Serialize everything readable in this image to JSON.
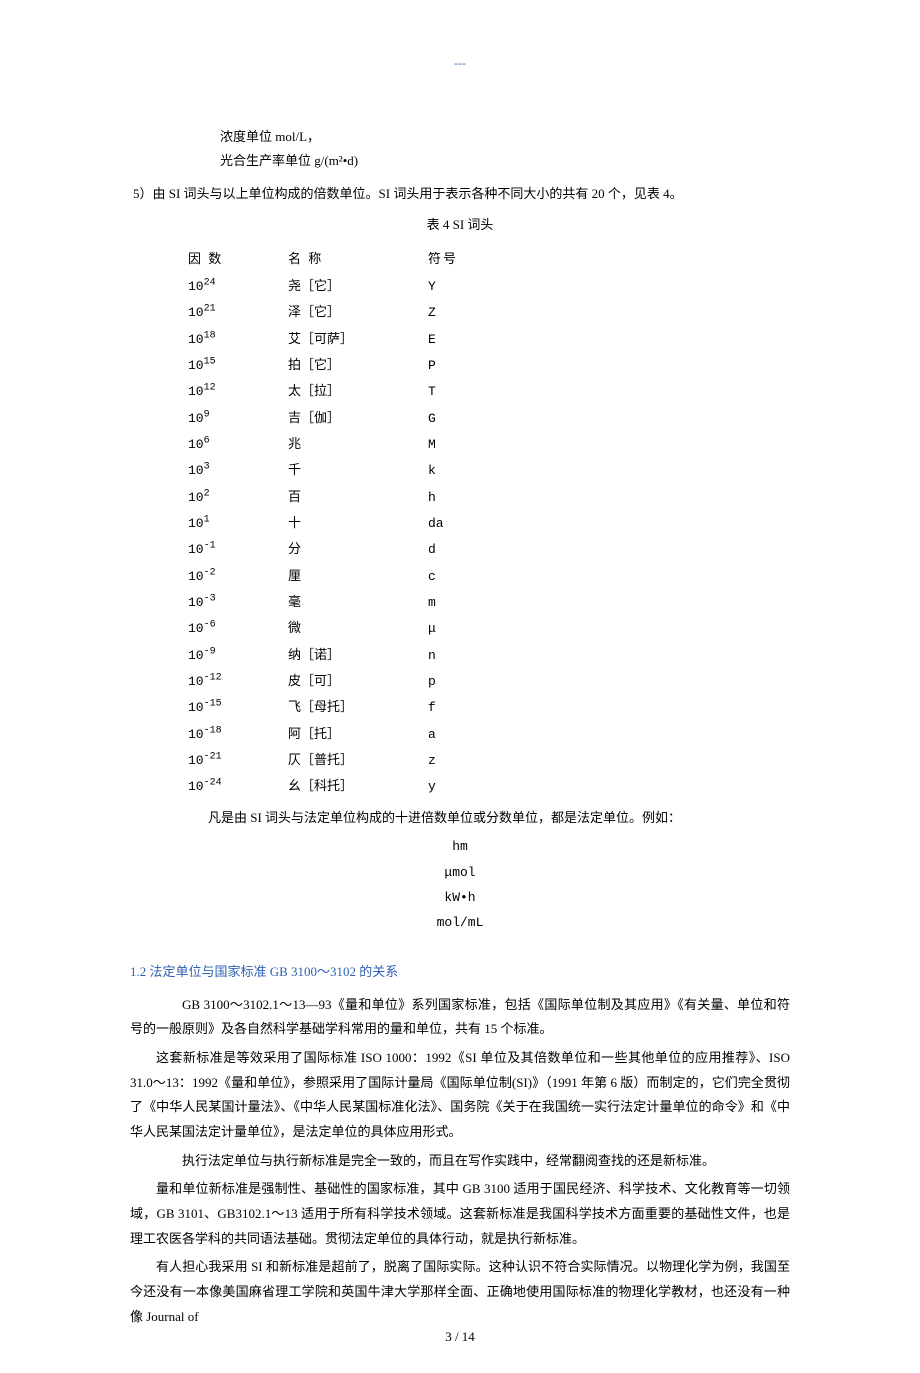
{
  "running_head": "---",
  "intro_lines": {
    "l1": "浓度单位 mol/L，",
    "l2": "光合生产率单位 g/(m²•d)",
    "l3": "5）由 SI 词头与以上单位构成的倍数单位。SI 词头用于表示各种不同大小的共有 20 个，见表 4。"
  },
  "table4": {
    "caption": "表 4  SI 词头",
    "header": {
      "c1": "因  数",
      "c2": "名  称",
      "c3": "符号"
    },
    "rows": [
      {
        "factor_base": "10",
        "factor_exp": "24",
        "name": "尧［它］",
        "symbol": "Y"
      },
      {
        "factor_base": "10",
        "factor_exp": "21",
        "name": "泽［它］",
        "symbol": "Z"
      },
      {
        "factor_base": "10",
        "factor_exp": "18",
        "name": "艾［可萨］",
        "symbol": "E"
      },
      {
        "factor_base": "10",
        "factor_exp": "15",
        "name": "拍［它］",
        "symbol": "P"
      },
      {
        "factor_base": "10",
        "factor_exp": "12",
        "name": "太［拉］",
        "symbol": "T"
      },
      {
        "factor_base": "10",
        "factor_exp": "9",
        "name": "吉［伽］",
        "symbol": "G"
      },
      {
        "factor_base": "10",
        "factor_exp": "6",
        "name": "兆",
        "symbol": "M"
      },
      {
        "factor_base": "10",
        "factor_exp": "3",
        "name": "千",
        "symbol": "k"
      },
      {
        "factor_base": "10",
        "factor_exp": "2",
        "name": "百",
        "symbol": "h"
      },
      {
        "factor_base": "10",
        "factor_exp": "1",
        "name": "十",
        "symbol": "da"
      },
      {
        "factor_base": "10",
        "factor_exp": "-1",
        "name": "分",
        "symbol": "d"
      },
      {
        "factor_base": "10",
        "factor_exp": "-2",
        "name": "厘",
        "symbol": "c"
      },
      {
        "factor_base": "10",
        "factor_exp": "-3",
        "name": "毫",
        "symbol": "m"
      },
      {
        "factor_base": "10",
        "factor_exp": "-6",
        "name": "微",
        "symbol": "μ"
      },
      {
        "factor_base": "10",
        "factor_exp": "-9",
        "name": "纳［诺］",
        "symbol": "n"
      },
      {
        "factor_base": "10",
        "factor_exp": "-12",
        "name": "皮［可］",
        "symbol": "p"
      },
      {
        "factor_base": "10",
        "factor_exp": "-15",
        "name": "飞［母托］",
        "symbol": "f"
      },
      {
        "factor_base": "10",
        "factor_exp": "-18",
        "name": "阿［托］",
        "symbol": "a"
      },
      {
        "factor_base": "10",
        "factor_exp": "-21",
        "name": "仄［普托］",
        "symbol": "z"
      },
      {
        "factor_base": "10",
        "factor_exp": "-24",
        "name": "幺［科托］",
        "symbol": "y"
      }
    ]
  },
  "post_table_line": "凡是由 SI 词头与法定单位构成的十进倍数单位或分数单位，都是法定单位。例如：",
  "examples": [
    "hm",
    "μmol",
    "kW•h",
    "mol/mL"
  ],
  "section12": {
    "heading": "1.2  法定单位与国家标准 GB 3100～3102 的关系",
    "p1": "GB 3100～3102.1～13—93《量和单位》系列国家标准，包括《国际单位制及其应用》《有关量、单位和符号的一般原则》及各自然科学基础学科常用的量和单位，共有 15 个标准。",
    "p2": "这套新标准是等效采用了国际标准 ISO 1000：1992《SI 单位及其倍数单位和一些其他单位的应用推荐》、ISO 31.0～13：1992《量和单位》，参照采用了国际计量局《国际单位制(SI)》（1991 年第 6 版）而制定的，它们完全贯彻了《中华人民某国计量法》、《中华人民某国标准化法》、国务院《关于在我国统一实行法定计量单位的命令》和《中华人民某国法定计量单位》，是法定单位的具体应用形式。",
    "p3": "执行法定单位与执行新标准是完全一致的，而且在写作实践中，经常翻阅查找的还是新标准。",
    "p4": "量和单位新标准是强制性、基础性的国家标准，其中 GB 3100 适用于国民经济、科学技术、文化教育等一切领域，GB 3101、GB3102.1～13 适用于所有科学技术领域。这套新标准是我国科学技术方面重要的基础性文件，也是理工农医各学科的共同语法基础。贯彻法定单位的具体行动，就是执行新标准。",
    "p5": "有人担心我采用 SI 和新标准是超前了，脱离了国际实际。这种认识不符合实际情况。以物理化学为例，我国至今还没有一本像美国麻省理工学院和英国牛津大学那样全面、正确地使用国际标准的物理化学教材，也还没有一种像 Journal of"
  },
  "footer": "3 / 14"
}
